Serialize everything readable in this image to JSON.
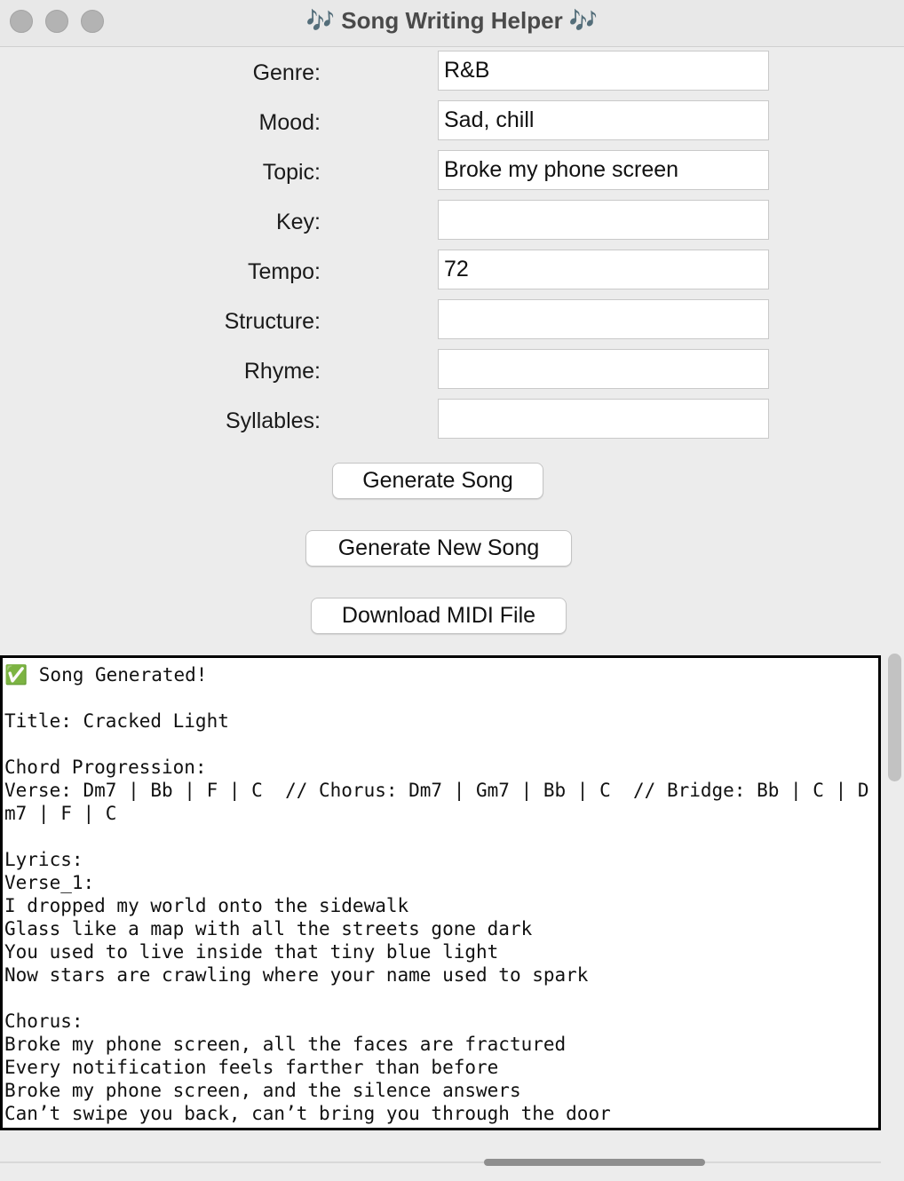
{
  "window": {
    "title": "🎶 Song Writing Helper 🎶"
  },
  "form": {
    "genre_label": "Genre:",
    "genre_value": "R&B",
    "mood_label": "Mood:",
    "mood_value": "Sad, chill",
    "topic_label": "Topic:",
    "topic_value": "Broke my phone screen",
    "key_label": "Key:",
    "key_value": "",
    "tempo_label": "Tempo:",
    "tempo_value": "72",
    "structure_label": "Structure:",
    "structure_value": "",
    "rhyme_label": "Rhyme:",
    "rhyme_value": "",
    "syllables_label": "Syllables:",
    "syllables_value": ""
  },
  "buttons": {
    "generate": "Generate Song",
    "generate_new": "Generate New Song",
    "download_midi": "Download MIDI File"
  },
  "output": {
    "text": "✅ Song Generated!\n\nTitle: Cracked Light\n\nChord Progression:\nVerse: Dm7 | Bb | F | C  // Chorus: Dm7 | Gm7 | Bb | C  // Bridge: Bb | C | Dm7 | F | C\n\nLyrics:\nVerse_1:\nI dropped my world onto the sidewalk\nGlass like a map with all the streets gone dark\nYou used to live inside that tiny blue light\nNow stars are crawling where your name used to spark\n\nChorus:\nBroke my phone screen, all the faces are fractured\nEvery notification feels farther than before\nBroke my phone screen, and the silence answers\nCan’t swipe you back, can’t bring you through the door"
  }
}
